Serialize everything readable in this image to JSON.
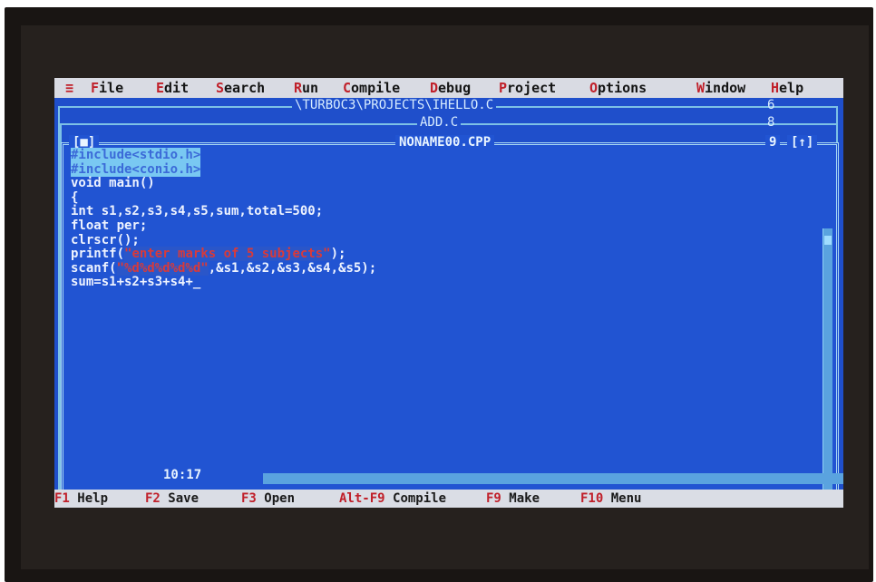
{
  "menu": {
    "system": "≡",
    "items": [
      {
        "hot": "F",
        "rest": "ile"
      },
      {
        "hot": "E",
        "rest": "dit"
      },
      {
        "hot": "S",
        "rest": "earch"
      },
      {
        "hot": "R",
        "rest": "un"
      },
      {
        "hot": "C",
        "rest": "ompile"
      },
      {
        "hot": "D",
        "rest": "ebug"
      },
      {
        "hot": "P",
        "rest": "roject"
      },
      {
        "hot": "O",
        "rest": "ptions"
      },
      {
        "hot": "W",
        "rest": "indow"
      },
      {
        "hot": "H",
        "rest": "elp"
      }
    ]
  },
  "windows": {
    "back1": {
      "title": "\\TURBOC3\\PROJECTS\\IHELLO.C",
      "num": "6"
    },
    "back2": {
      "title": "ADD.C",
      "num": "8"
    },
    "editor": {
      "close": "[■]",
      "title": "NONAME00.CPP",
      "num": "9",
      "zoom": "[↑]",
      "cursor_pos": "10:17"
    }
  },
  "code": {
    "line1": "#include<stdio.h>",
    "line2": "#include<conio.h>",
    "line3": "void main()",
    "line4": "{",
    "line5": "int s1,s2,s3,s4,s5,sum,total=500;",
    "line6": "float per;",
    "line7": "clrscr();",
    "line8a": "printf(",
    "line8b": "\"enter marks of 5 subjects\"",
    "line8c": ");",
    "line9a": "scanf(",
    "line9b": "\"%d%d%d%d%d\"",
    "line9c": ",&s1,&s2,&s3,&s4,&s5);",
    "line10": "sum=s1+s2+s3+s4+_"
  },
  "status": [
    {
      "key": "F1",
      "label": "Help"
    },
    {
      "key": "F2",
      "label": "Save"
    },
    {
      "key": "F3",
      "label": "Open"
    },
    {
      "key": "Alt-F9",
      "label": "Compile"
    },
    {
      "key": "F9",
      "label": "Make"
    },
    {
      "key": "F10",
      "label": "Menu"
    }
  ],
  "colors": {
    "editor_bg": "#2154d2",
    "menubar_bg": "#d9dbe3",
    "highlight": "#c0202a"
  }
}
